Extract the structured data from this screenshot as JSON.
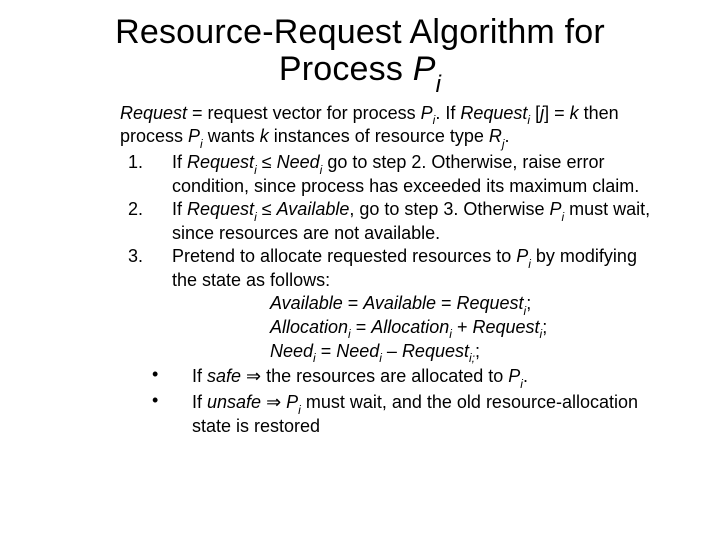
{
  "title": {
    "line1_a": "Resource-Request Algorithm for",
    "line2_a": "Process ",
    "line2_b": "P",
    "line2_sub": "i"
  },
  "intro": {
    "a": "Request",
    "b": " = request vector for process ",
    "c": "P",
    "csub": "i",
    "d": ".  If ",
    "e": "Request",
    "esub": "i",
    "f": " [",
    "g": "j",
    "h": "] = ",
    "k": "k",
    "l": " then process ",
    "m": "P",
    "msub": "i",
    "n": " wants ",
    "o": "k",
    "p": " instances of resource type ",
    "q": "R",
    "qsub": "j",
    "r": "."
  },
  "step1": {
    "num": "1.",
    "a": "If ",
    "b": "Request",
    "bsub": "i",
    "c": " ≤ ",
    "d": "Need",
    "dsub": "i",
    "e": " go to step 2.  Otherwise, raise error condition, since process has exceeded its maximum claim."
  },
  "step2": {
    "num": "2.",
    "a": "If ",
    "b": "Request",
    "bsub": "i",
    "c": " ≤ ",
    "d": "Available",
    "e": ", go to step 3.  Otherwise ",
    "f": "P",
    "fsub": "i",
    "g": " must wait, since resources are not available."
  },
  "step3": {
    "num": "3.",
    "a": "Pretend to allocate requested resources to ",
    "b": "P",
    "bsub": "i",
    "c": " by modifying the state as follows:"
  },
  "eq1": {
    "a": "Available",
    "b": " = ",
    "c": "Available",
    "d": " = ",
    "e": "Request",
    "esub": "i",
    "f": ";"
  },
  "eq2": {
    "a": "Allocation",
    "asub": "i",
    "b": " = ",
    "c": "Allocation",
    "csub": "i",
    "d": " + ",
    "e": "Request",
    "esub": "i",
    "f": ";"
  },
  "eq3": {
    "a": "Need",
    "asub": "i",
    "b": " = ",
    "c": "Need",
    "csub": "i",
    "d": " – ",
    "e": "Request",
    "esub": "i;",
    "f": ";"
  },
  "bul1": {
    "dot": "•",
    "a": "If ",
    "b": "safe",
    "c": " ⇒ the resources are allocated to ",
    "d": "P",
    "dsub": "i",
    "e": "."
  },
  "bul2": {
    "dot": "•",
    "a": "If ",
    "b": "unsafe",
    "c": " ⇒ ",
    "d": "P",
    "dsub": "i",
    "e": " must wait, and the old resource-allocation state is restored"
  }
}
